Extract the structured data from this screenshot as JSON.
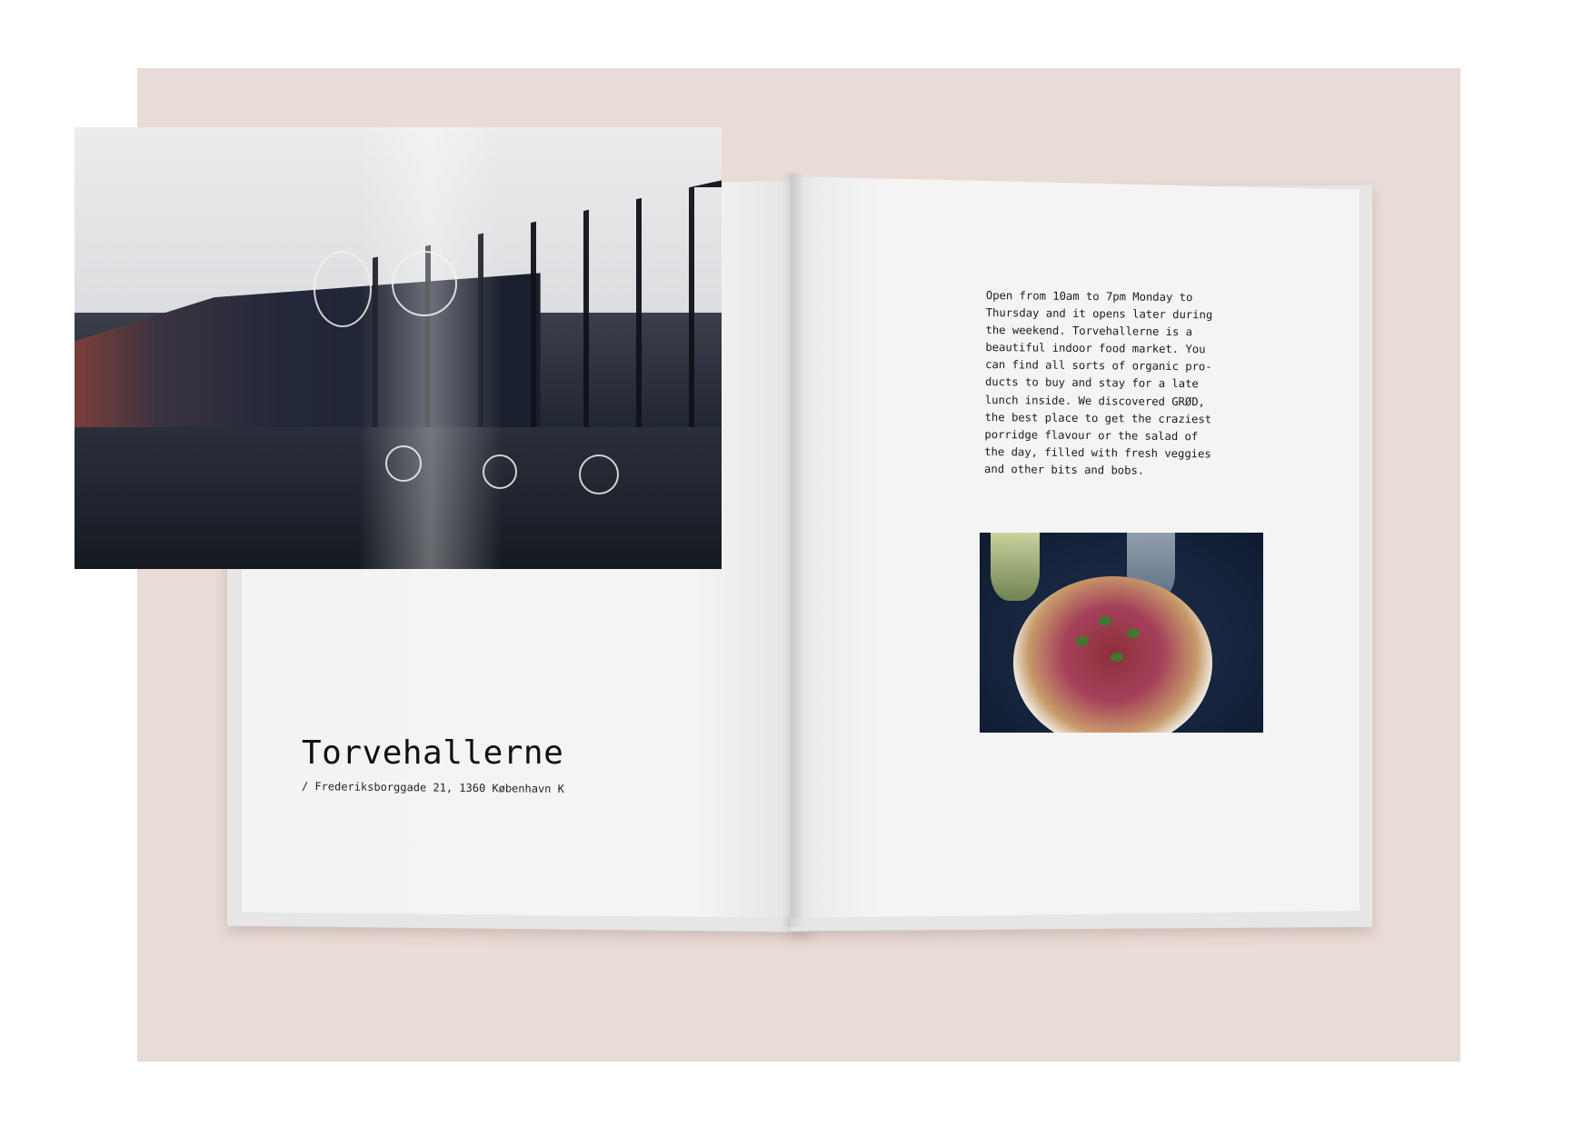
{
  "spread": {
    "left_page": {
      "title": "Torvehallerne",
      "address": "/ Frederiksborggade 21, 1360 København K",
      "photo": "market-hall-photo"
    },
    "right_page": {
      "body_lines": [
        "Open from 10am to 7pm Monday to",
        "Thursday and it opens later during",
        "the weekend. Torvehallerne is a",
        "beautiful indoor food market. You",
        "can find all sorts of organic pro-",
        "ducts to buy and stay for a late",
        "lunch inside. We discovered GRØD,",
        "the best place to get the craziest",
        "porridge flavour or the salad of",
        "the day, filled with fresh veggies",
        "and other bits and bobs."
      ],
      "photo": "salad-bowl-photo"
    }
  },
  "colors": {
    "backdrop": "#e9dbd6",
    "page": "#f4f4f4",
    "text": "#111111"
  }
}
